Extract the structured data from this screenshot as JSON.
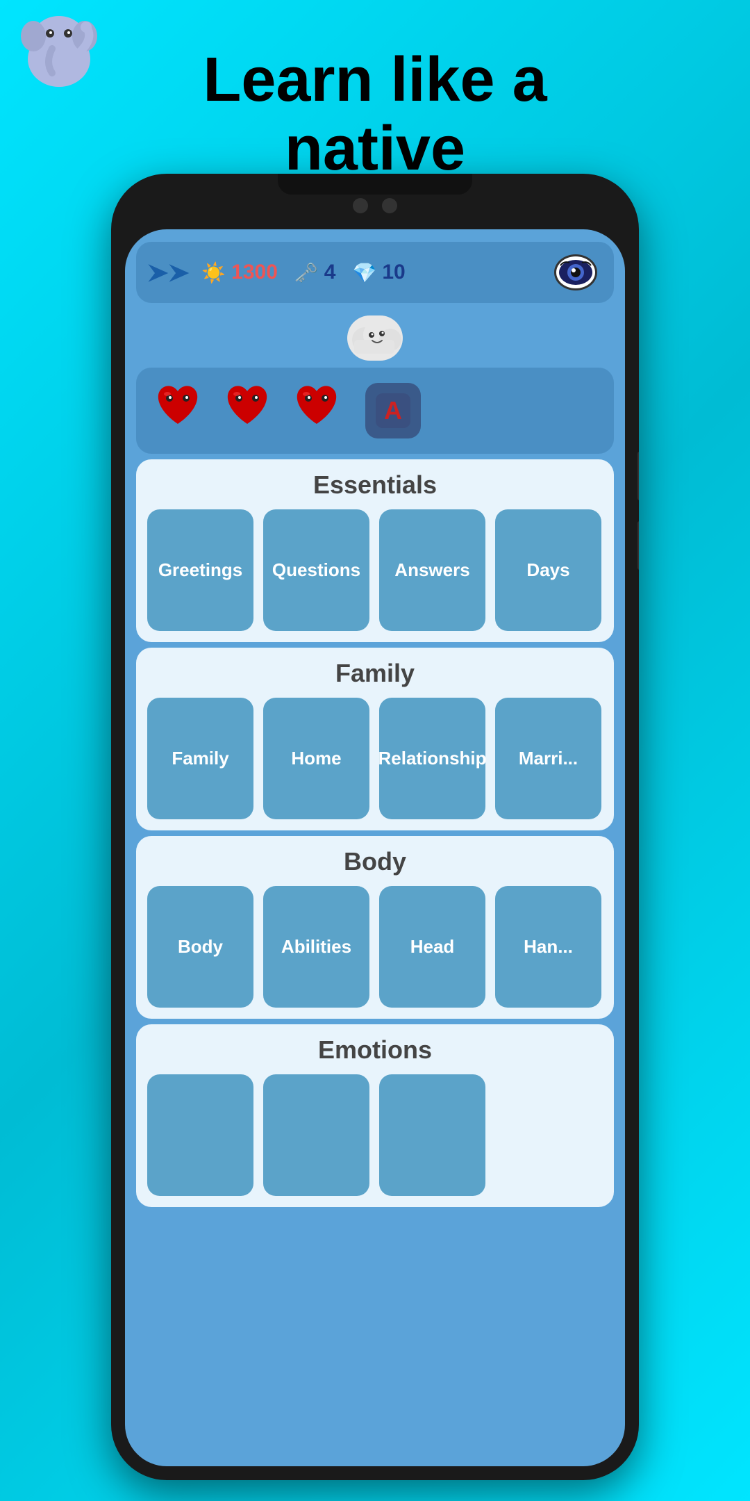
{
  "header": {
    "title_line1": "Learn like a",
    "title_line2": "native"
  },
  "status_bar": {
    "energy": "1300",
    "keys": "4",
    "gems": "10"
  },
  "hearts": {
    "count": 3,
    "letter": "A"
  },
  "sections": [
    {
      "id": "essentials",
      "title": "Essentials",
      "cards": [
        {
          "label": "Greetings"
        },
        {
          "label": "Questions"
        },
        {
          "label": "Answers"
        },
        {
          "label": "Days"
        }
      ]
    },
    {
      "id": "family",
      "title": "Family",
      "cards": [
        {
          "label": "Family"
        },
        {
          "label": "Home"
        },
        {
          "label": "Relationship"
        },
        {
          "label": "Marri..."
        }
      ]
    },
    {
      "id": "body",
      "title": "Body",
      "cards": [
        {
          "label": "Body"
        },
        {
          "label": "Abilities"
        },
        {
          "label": "Head"
        },
        {
          "label": "Han..."
        }
      ]
    },
    {
      "id": "emotions",
      "title": "Emotions",
      "cards": [
        {
          "label": ""
        },
        {
          "label": ""
        },
        {
          "label": ""
        }
      ]
    }
  ]
}
